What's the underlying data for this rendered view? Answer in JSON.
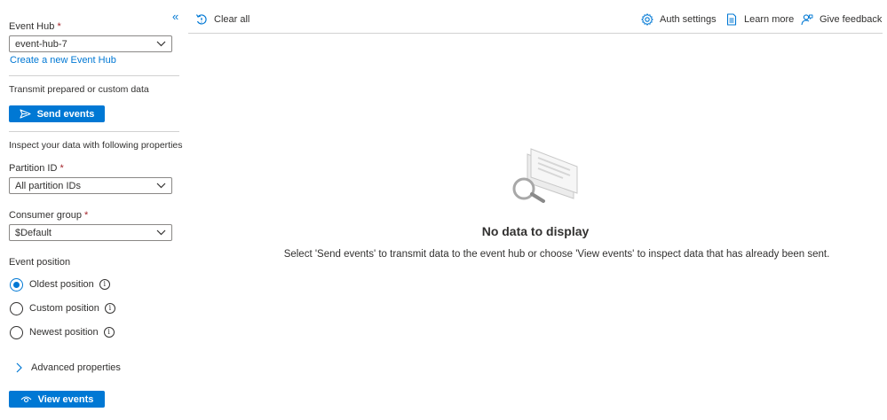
{
  "sidebar": {
    "event_hub_label": "Event Hub",
    "required_mark": "*",
    "event_hub_value": "event-hub-7",
    "create_link": "Create a new Event Hub",
    "transmit_text": "Transmit prepared or custom data",
    "send_button": "Send events",
    "inspect_text": "Inspect your data with following properties",
    "partition_label": "Partition ID",
    "partition_value": "All partition IDs",
    "consumer_label": "Consumer group",
    "consumer_value": "$Default",
    "position_label": "Event position",
    "positions": [
      {
        "label": "Oldest position",
        "checked": true
      },
      {
        "label": "Custom position",
        "checked": false
      },
      {
        "label": "Newest position",
        "checked": false
      }
    ],
    "advanced_label": "Advanced properties",
    "view_button": "View events"
  },
  "toolbar": {
    "clear_all": "Clear all",
    "auth_settings": "Auth settings",
    "learn_more": "Learn more",
    "give_feedback": "Give feedback"
  },
  "main": {
    "empty_title": "No data to display",
    "empty_description": "Select 'Send events' to transmit data to the event hub or choose 'View events' to inspect data that has already been sent."
  },
  "colors": {
    "accent": "#0078d4",
    "required": "#a4262c",
    "text": "#323130",
    "border": "#8a8886"
  }
}
